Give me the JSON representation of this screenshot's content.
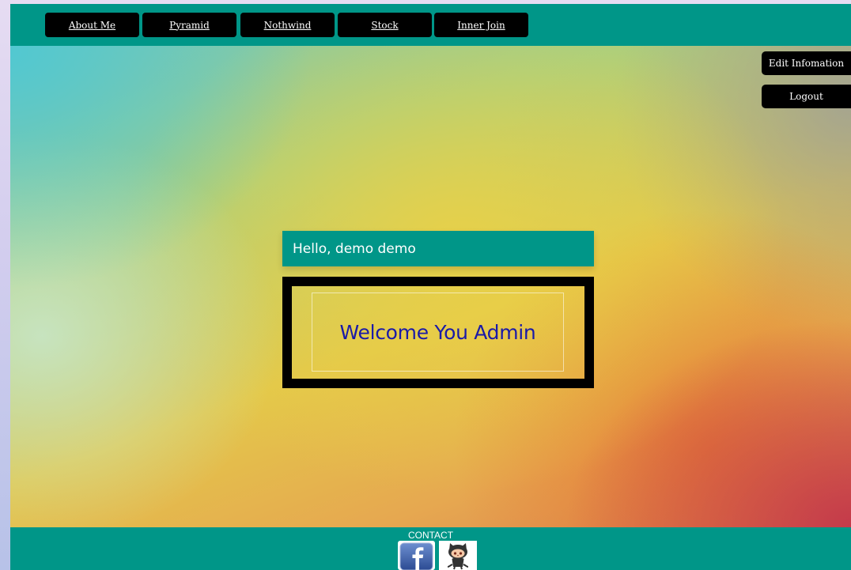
{
  "nav": {
    "items": [
      {
        "label": "About Me"
      },
      {
        "label": "Pyramid"
      },
      {
        "label": "Nothwind"
      },
      {
        "label": "Stock"
      },
      {
        "label": "Inner Join"
      }
    ]
  },
  "side": {
    "edit_label": "Edit Infomation",
    "logout_label": "Logout"
  },
  "main": {
    "greeting": "Hello, demo demo",
    "welcome": "Welcome You Admin"
  },
  "footer": {
    "contact_label": "CONTACT",
    "icons": [
      "facebook-icon",
      "github-octocat-icon"
    ]
  },
  "colors": {
    "accent": "#009688",
    "button": "#000000",
    "welcome_text": "#1a1aa8"
  }
}
